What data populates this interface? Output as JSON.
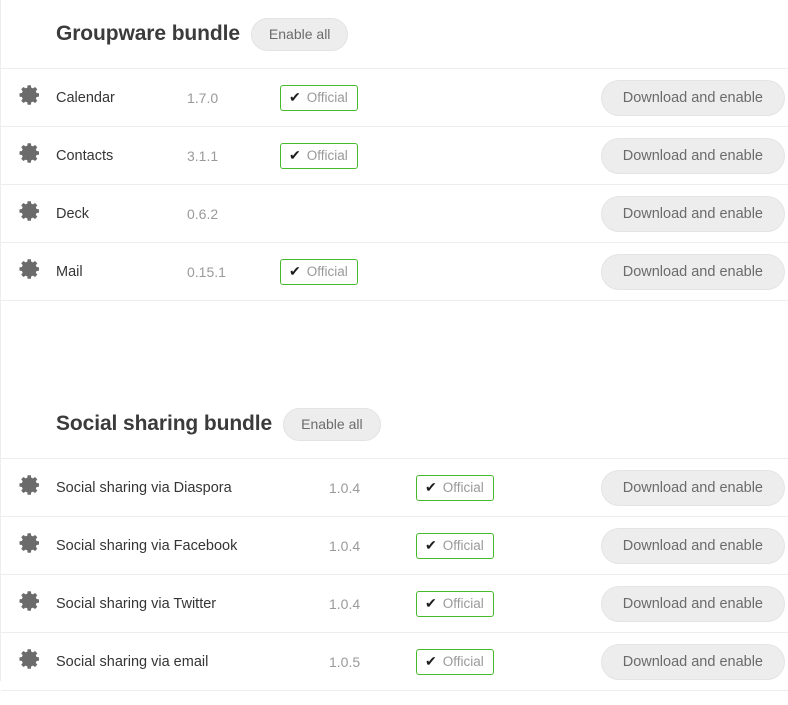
{
  "labels": {
    "enable_all": "Enable all",
    "download_and_enable": "Download and enable",
    "official": "Official",
    "check_mark": "✔"
  },
  "colors": {
    "official_border": "#46ba2a",
    "button_bg": "#ededed",
    "row_border": "#ededed",
    "name_text": "#353535",
    "version_text": "#9a9a9a",
    "heading_text": "#3b3b3b"
  },
  "icons": {
    "app_settings": "gear-icon"
  },
  "bundles": [
    {
      "title": "Groupware bundle",
      "enable_all_label": "Enable all",
      "apps": [
        {
          "icon": "gear-icon",
          "name": "Calendar",
          "version": "1.7.0",
          "level": "Official",
          "official": true,
          "action": "Download and enable"
        },
        {
          "icon": "gear-icon",
          "name": "Contacts",
          "version": "3.1.1",
          "level": "Official",
          "official": true,
          "action": "Download and enable"
        },
        {
          "icon": "gear-icon",
          "name": "Deck",
          "version": "0.6.2",
          "level": "",
          "official": false,
          "action": "Download and enable"
        },
        {
          "icon": "gear-icon",
          "name": "Mail",
          "version": "0.15.1",
          "level": "Official",
          "official": true,
          "action": "Download and enable"
        }
      ]
    },
    {
      "title": "Social sharing bundle",
      "enable_all_label": "Enable all",
      "apps": [
        {
          "icon": "gear-icon",
          "name": "Social sharing via Diaspora",
          "version": "1.0.4",
          "level": "Official",
          "official": true,
          "action": "Download and enable"
        },
        {
          "icon": "gear-icon",
          "name": "Social sharing via Facebook",
          "version": "1.0.4",
          "level": "Official",
          "official": true,
          "action": "Download and enable"
        },
        {
          "icon": "gear-icon",
          "name": "Social sharing via Twitter",
          "version": "1.0.4",
          "level": "Official",
          "official": true,
          "action": "Download and enable"
        },
        {
          "icon": "gear-icon",
          "name": "Social sharing via email",
          "version": "1.0.5",
          "level": "Official",
          "official": true,
          "action": "Download and enable"
        }
      ]
    }
  ]
}
